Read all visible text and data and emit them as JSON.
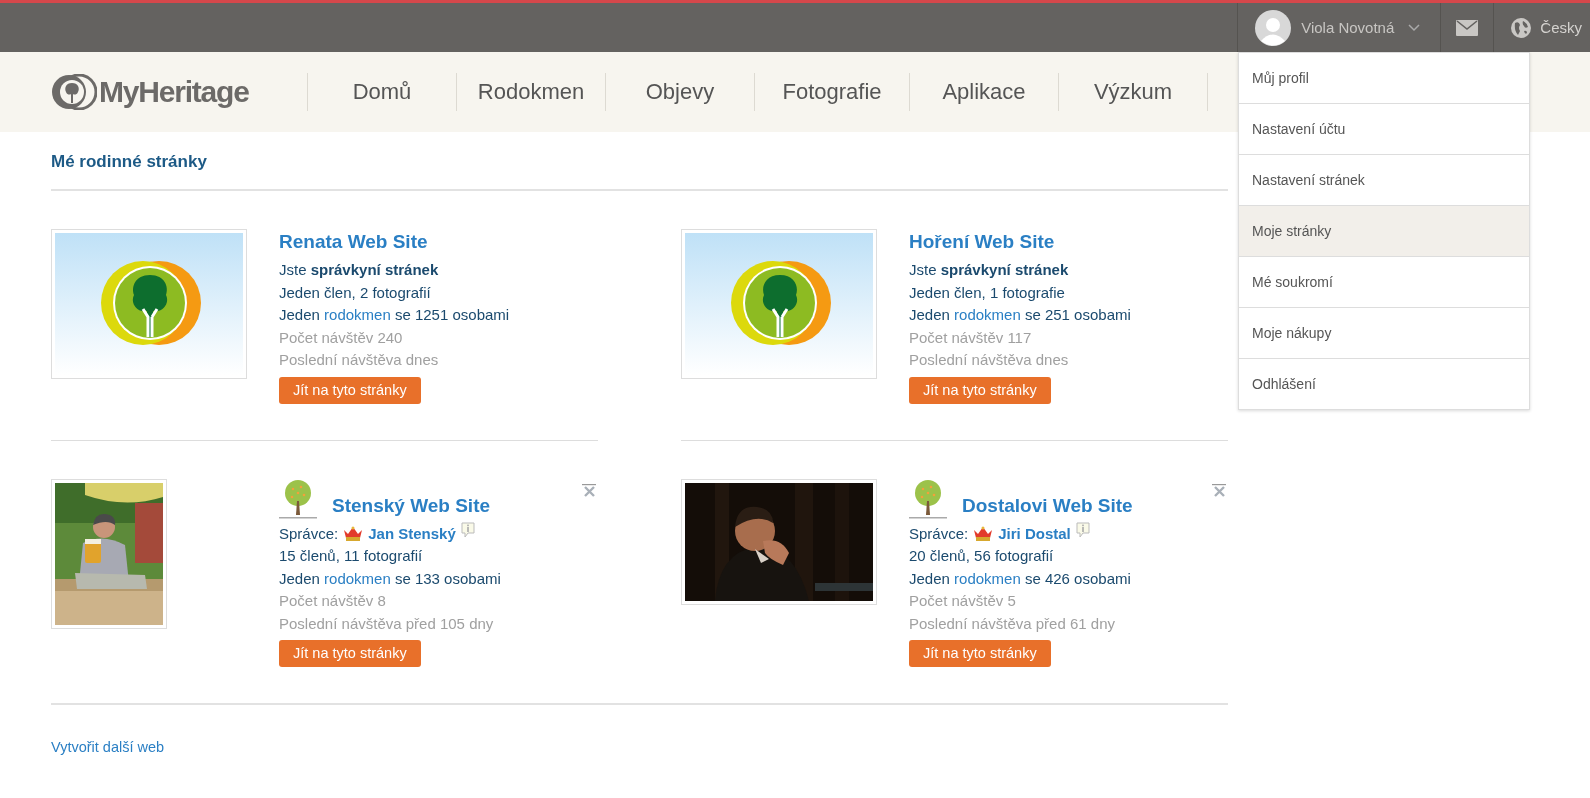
{
  "topbar": {
    "user_name": "Viola Novotná",
    "language": "Česky"
  },
  "logo": {
    "text": "MyHeritage"
  },
  "nav": [
    {
      "label": "Domů"
    },
    {
      "label": "Rodokmen"
    },
    {
      "label": "Objevy"
    },
    {
      "label": "Fotografie"
    },
    {
      "label": "Aplikace"
    },
    {
      "label": "Výzkum"
    }
  ],
  "account_menu": [
    {
      "label": "Můj profil",
      "selected": false
    },
    {
      "label": "Nastavení účtu",
      "selected": false
    },
    {
      "label": "Nastavení stránek",
      "selected": false
    },
    {
      "label": "Moje stránky",
      "selected": true
    },
    {
      "label": "Mé soukromí",
      "selected": false
    },
    {
      "label": "Moje nákupy",
      "selected": false
    },
    {
      "label": "Odhlášení",
      "selected": false
    }
  ],
  "heading": "Mé rodinné stránky",
  "sites": [
    {
      "title": "Renata Web Site",
      "kind": "logo",
      "tree_icon": false,
      "removable": false,
      "role": {
        "kind": "self",
        "text": "Jste **správkyní stránek**"
      },
      "members": "Jeden člen, 2 fotografií",
      "tree": {
        "before": "Jeden",
        "link": "rodokmen",
        "after": "se 1251 osobami"
      },
      "visits": "Počet návštěv 240",
      "last_visit": "Poslední návštěva dnes",
      "button": "Jít na tyto stránky"
    },
    {
      "title": "Hoření Web Site",
      "kind": "logo",
      "tree_icon": false,
      "removable": false,
      "role": {
        "kind": "self",
        "text": "Jste **správkyní stránek**"
      },
      "members": "Jeden člen, 1 fotografie",
      "tree": {
        "before": "Jeden",
        "link": "rodokmen",
        "after": "se 251 osobami"
      },
      "visits": "Počet návštěv 117",
      "last_visit": "Poslední návštěva dnes",
      "button": "Jít na tyto stránky"
    },
    {
      "title": "Stenský Web Site",
      "kind": "photo-portrait",
      "tree_icon": true,
      "removable": true,
      "role": {
        "kind": "admin",
        "label": "Správce:",
        "name": "Jan Stenský"
      },
      "members": "15 členů, 11 fotografií",
      "tree": {
        "before": "Jeden",
        "link": "rodokmen",
        "after": "se 133 osobami"
      },
      "visits": "Počet návštěv 8",
      "last_visit": "Poslední návštěva před 105 dny",
      "button": "Jít na tyto stránky"
    },
    {
      "title": "Dostalovi Web Site",
      "kind": "photo-landscape",
      "tree_icon": true,
      "removable": true,
      "role": {
        "kind": "admin",
        "label": "Správce:",
        "name": "Jiri Dostal"
      },
      "members": "20 členů, 56 fotografií",
      "tree": {
        "before": "Jeden",
        "link": "rodokmen",
        "after": "se 426 osobami"
      },
      "visits": "Počet návštěv 5",
      "last_visit": "Poslední návštěva před 61 dny",
      "button": "Jít na tyto stránky"
    }
  ],
  "create_link": "Vytvořit další web"
}
